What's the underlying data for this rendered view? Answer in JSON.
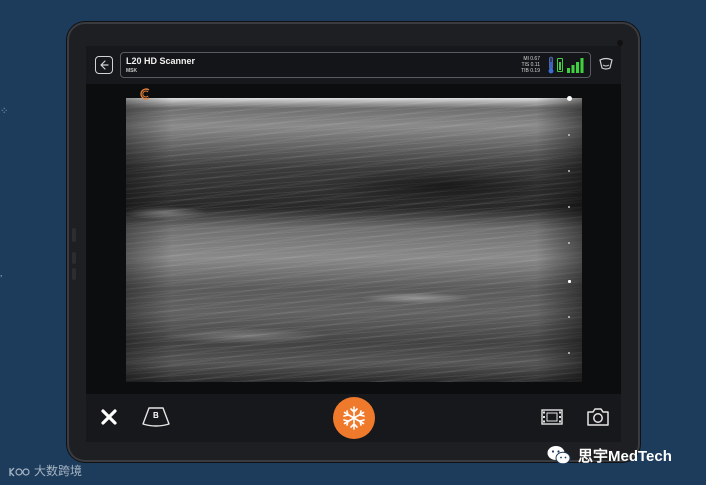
{
  "device": {
    "probe_name": "L20 HD Scanner",
    "preset": "MSK",
    "indices": [
      "MI 0.67",
      "TIS 0.11",
      "TIB 0.19"
    ],
    "battery_level": 0.7
  },
  "colors": {
    "accent": "#f07a2c",
    "battery": "#3fd23f",
    "thermometer": "#3b6fd8"
  },
  "bottom_bar": {
    "mode_badge": "B"
  },
  "icons": {
    "back": "back-arrow-icon",
    "probe": "probe-icon",
    "close": "close-icon",
    "mode": "b-mode-icon",
    "freeze": "snowflake-icon",
    "cine": "film-icon",
    "capture": "camera-icon"
  },
  "watermarks": {
    "left": "大数跨境",
    "right": "思宇MedTech"
  }
}
